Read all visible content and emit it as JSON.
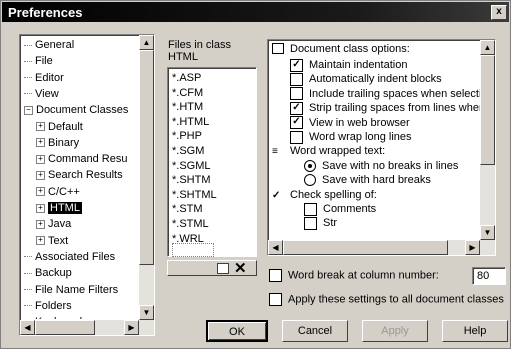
{
  "window": {
    "title": "Preferences",
    "close_glyph": "x"
  },
  "tree": {
    "items": [
      {
        "label": "General",
        "indent": 0,
        "expander": ""
      },
      {
        "label": "File",
        "indent": 0,
        "expander": ""
      },
      {
        "label": "Editor",
        "indent": 0,
        "expander": ""
      },
      {
        "label": "View",
        "indent": 0,
        "expander": ""
      },
      {
        "label": "Document Classes",
        "indent": 0,
        "expander": "−"
      },
      {
        "label": "Default",
        "indent": 1,
        "expander": "+"
      },
      {
        "label": "Binary",
        "indent": 1,
        "expander": "+"
      },
      {
        "label": "Command Resu",
        "indent": 1,
        "expander": "+"
      },
      {
        "label": "Search Results",
        "indent": 1,
        "expander": "+"
      },
      {
        "label": "C/C++",
        "indent": 1,
        "expander": "+"
      },
      {
        "label": "HTML",
        "indent": 1,
        "expander": "+",
        "selected": true
      },
      {
        "label": "Java",
        "indent": 1,
        "expander": "+"
      },
      {
        "label": "Text",
        "indent": 1,
        "expander": "+"
      },
      {
        "label": "Associated Files",
        "indent": 0,
        "expander": ""
      },
      {
        "label": "Backup",
        "indent": 0,
        "expander": ""
      },
      {
        "label": "File Name Filters",
        "indent": 0,
        "expander": ""
      },
      {
        "label": "Folders",
        "indent": 0,
        "expander": ""
      },
      {
        "label": "Keyboard",
        "indent": 0,
        "expander": ""
      }
    ]
  },
  "files_label": {
    "line1": "Files in class",
    "line2": "HTML"
  },
  "file_types": [
    "*.ASP",
    "*.CFM",
    "*.HTM",
    "*.HTML",
    "*.PHP",
    "*.SGM",
    "*.SGML",
    "*.SHTM",
    "*.SHTML",
    "*.STM",
    "*.STML",
    "*.WRL"
  ],
  "options": {
    "header": "Document class options:",
    "items": [
      {
        "label": "Maintain indentation",
        "kind": "checkbox",
        "checked": true
      },
      {
        "label": "Automatically indent blocks",
        "kind": "checkbox",
        "checked": false
      },
      {
        "label": "Include trailing spaces when selecting w",
        "kind": "checkbox",
        "checked": false
      },
      {
        "label": "Strip trailing spaces from lines when sav",
        "kind": "checkbox",
        "checked": true
      },
      {
        "label": "View in web browser",
        "kind": "checkbox",
        "checked": true
      },
      {
        "label": "Word wrap long lines",
        "kind": "checkbox",
        "checked": false
      },
      {
        "label": "Word wrapped text:",
        "kind": "header"
      },
      {
        "label": "Save with no breaks in lines",
        "kind": "radio",
        "checked": true
      },
      {
        "label": "Save with hard breaks",
        "kind": "radio",
        "checked": false
      },
      {
        "label": "Check spelling of:",
        "kind": "header"
      },
      {
        "label": "Comments",
        "kind": "checkbox",
        "checked": false
      },
      {
        "label": "Str",
        "kind": "checkbox",
        "checked": false
      }
    ]
  },
  "word_break": {
    "label": "Word break at column number:",
    "value": "80",
    "checked": false
  },
  "apply_all": {
    "label": "Apply these settings to all document classes",
    "checked": false
  },
  "buttons": {
    "ok": "OK",
    "cancel": "Cancel",
    "apply": "Apply",
    "help": "Help"
  }
}
